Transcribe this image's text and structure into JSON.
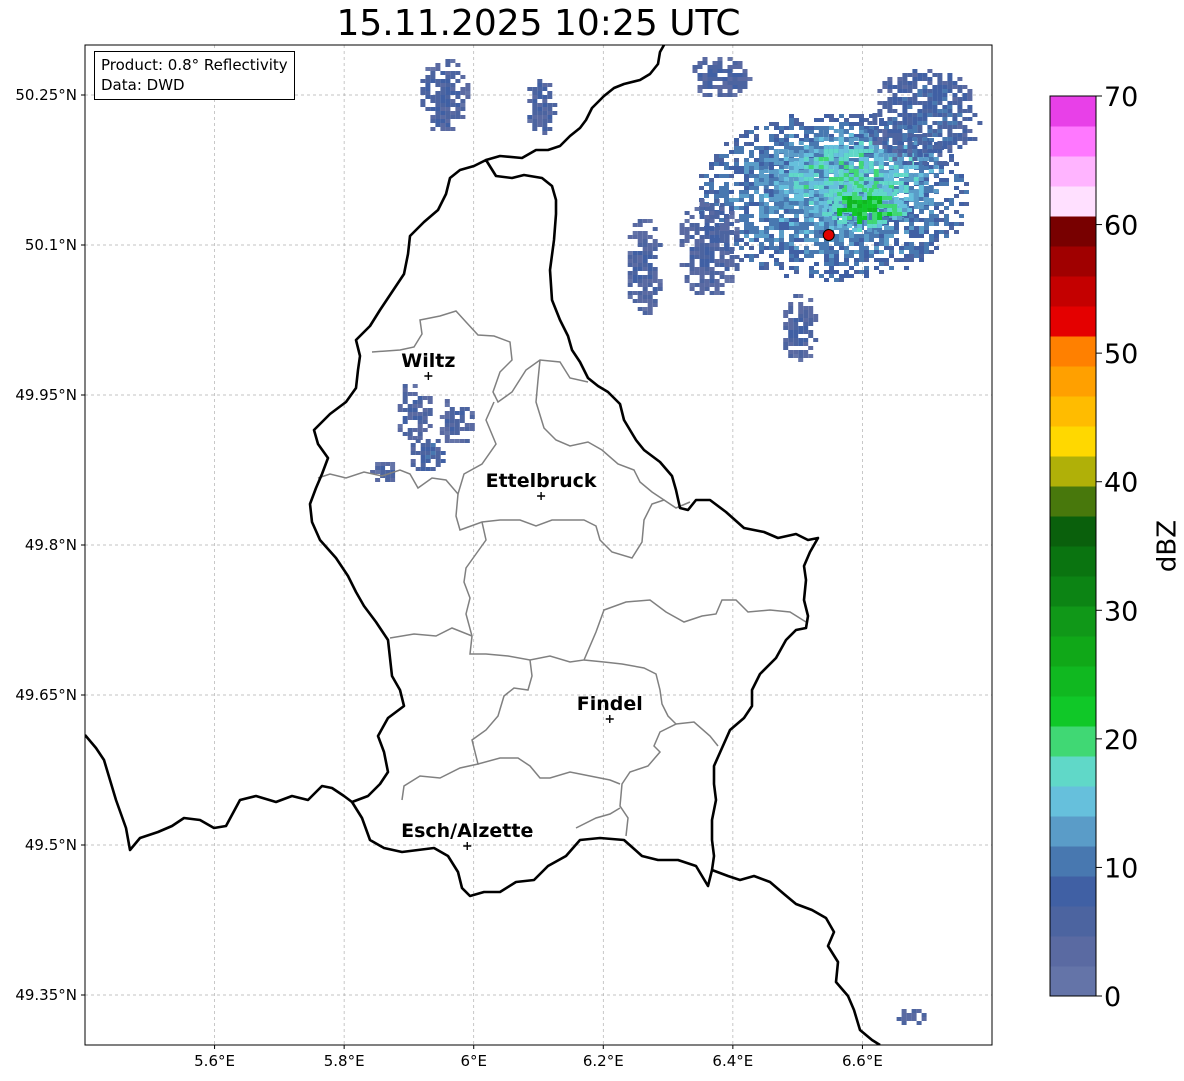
{
  "title": "15.11.2025 10:25 UTC",
  "info": {
    "product": "Product: 0.8° Reflectivity",
    "data": "Data: DWD"
  },
  "map": {
    "lon_range": [
      5.4,
      6.8
    ],
    "lat_range": [
      49.3,
      50.3
    ],
    "lon_ticks": [
      {
        "value": 5.6,
        "label": "5.6°E"
      },
      {
        "value": 5.8,
        "label": "5.8°E"
      },
      {
        "value": 6.0,
        "label": "6°E"
      },
      {
        "value": 6.2,
        "label": "6.2°E"
      },
      {
        "value": 6.4,
        "label": "6.4°E"
      },
      {
        "value": 6.6,
        "label": "6.6°E"
      }
    ],
    "lat_ticks": [
      {
        "value": 50.25,
        "label": "50.25°N"
      },
      {
        "value": 50.1,
        "label": "50.1°N"
      },
      {
        "value": 49.95,
        "label": "49.95°N"
      },
      {
        "value": 49.8,
        "label": "49.8°N"
      },
      {
        "value": 49.65,
        "label": "49.65°N"
      },
      {
        "value": 49.5,
        "label": "49.5°N"
      },
      {
        "value": 49.35,
        "label": "49.35°N"
      }
    ],
    "grid": "dashed",
    "cities": [
      {
        "name": "Wiltz",
        "lon": 5.93,
        "lat": 49.969
      },
      {
        "name": "Ettelbruck",
        "lon": 6.104,
        "lat": 49.849
      },
      {
        "name": "Findel",
        "lon": 6.21,
        "lat": 49.626
      },
      {
        "name": "Esch/Alzette",
        "lon": 5.99,
        "lat": 49.499
      }
    ],
    "radar_site": {
      "lon": 6.548,
      "lat": 50.11,
      "color": "#e00000"
    },
    "colors": {
      "border": "#000000",
      "district": "#808080",
      "grid": "#b0b0b0"
    },
    "echo_areas": [
      {
        "lon": 6.55,
        "lat": 50.15,
        "rlon": 0.21,
        "rlat": 0.085,
        "dbz": 12
      },
      {
        "lon": 6.58,
        "lat": 50.17,
        "rlon": 0.14,
        "rlat": 0.05,
        "dbz": 17
      },
      {
        "lon": 6.6,
        "lat": 50.14,
        "rlon": 0.07,
        "rlat": 0.025,
        "dbz": 22
      },
      {
        "lon": 6.69,
        "lat": 50.23,
        "rlon": 0.09,
        "rlat": 0.05,
        "dbz": 8
      },
      {
        "lon": 6.36,
        "lat": 50.1,
        "rlon": 0.05,
        "rlat": 0.05,
        "dbz": 6
      },
      {
        "lon": 6.26,
        "lat": 50.08,
        "rlon": 0.03,
        "rlat": 0.05,
        "dbz": 6
      },
      {
        "lon": 6.5,
        "lat": 50.02,
        "rlon": 0.03,
        "rlat": 0.035,
        "dbz": 6
      },
      {
        "lon": 6.38,
        "lat": 50.27,
        "rlon": 0.05,
        "rlat": 0.022,
        "dbz": 6
      },
      {
        "lon": 5.95,
        "lat": 50.25,
        "rlon": 0.04,
        "rlat": 0.04,
        "dbz": 6
      },
      {
        "lon": 6.1,
        "lat": 50.24,
        "rlon": 0.025,
        "rlat": 0.03,
        "dbz": 6
      },
      {
        "lon": 5.905,
        "lat": 49.935,
        "rlon": 0.03,
        "rlat": 0.03,
        "dbz": 5
      },
      {
        "lon": 5.97,
        "lat": 49.925,
        "rlon": 0.03,
        "rlat": 0.025,
        "dbz": 5
      },
      {
        "lon": 5.925,
        "lat": 49.89,
        "rlon": 0.03,
        "rlat": 0.02,
        "dbz": 8
      },
      {
        "lon": 5.86,
        "lat": 49.875,
        "rlon": 0.02,
        "rlat": 0.012,
        "dbz": 5
      },
      {
        "lon": 6.67,
        "lat": 49.33,
        "rlon": 0.025,
        "rlat": 0.01,
        "dbz": 5
      }
    ]
  },
  "colorbar": {
    "label": "dBZ",
    "min": 0,
    "max": 70,
    "step": 2.5,
    "tick_labels": [
      "0",
      "10",
      "20",
      "30",
      "40",
      "50",
      "60",
      "70"
    ],
    "colors": [
      "#6474a8",
      "#5a6aa2",
      "#4c64a0",
      "#4060a4",
      "#4878b0",
      "#5a9cc8",
      "#66c0dc",
      "#60d8c8",
      "#40d874",
      "#10c828",
      "#10b820",
      "#10a818",
      "#109818",
      "#0c8414",
      "#0a7410",
      "#0a600c",
      "#48780c",
      "#b0b008",
      "#ffd800",
      "#ffbc00",
      "#ffa000",
      "#ff8000",
      "#e40000",
      "#c40000",
      "#a00000",
      "#780000",
      "#ffe0ff",
      "#ffb4ff",
      "#ff78ff",
      "#e840e8"
    ]
  }
}
